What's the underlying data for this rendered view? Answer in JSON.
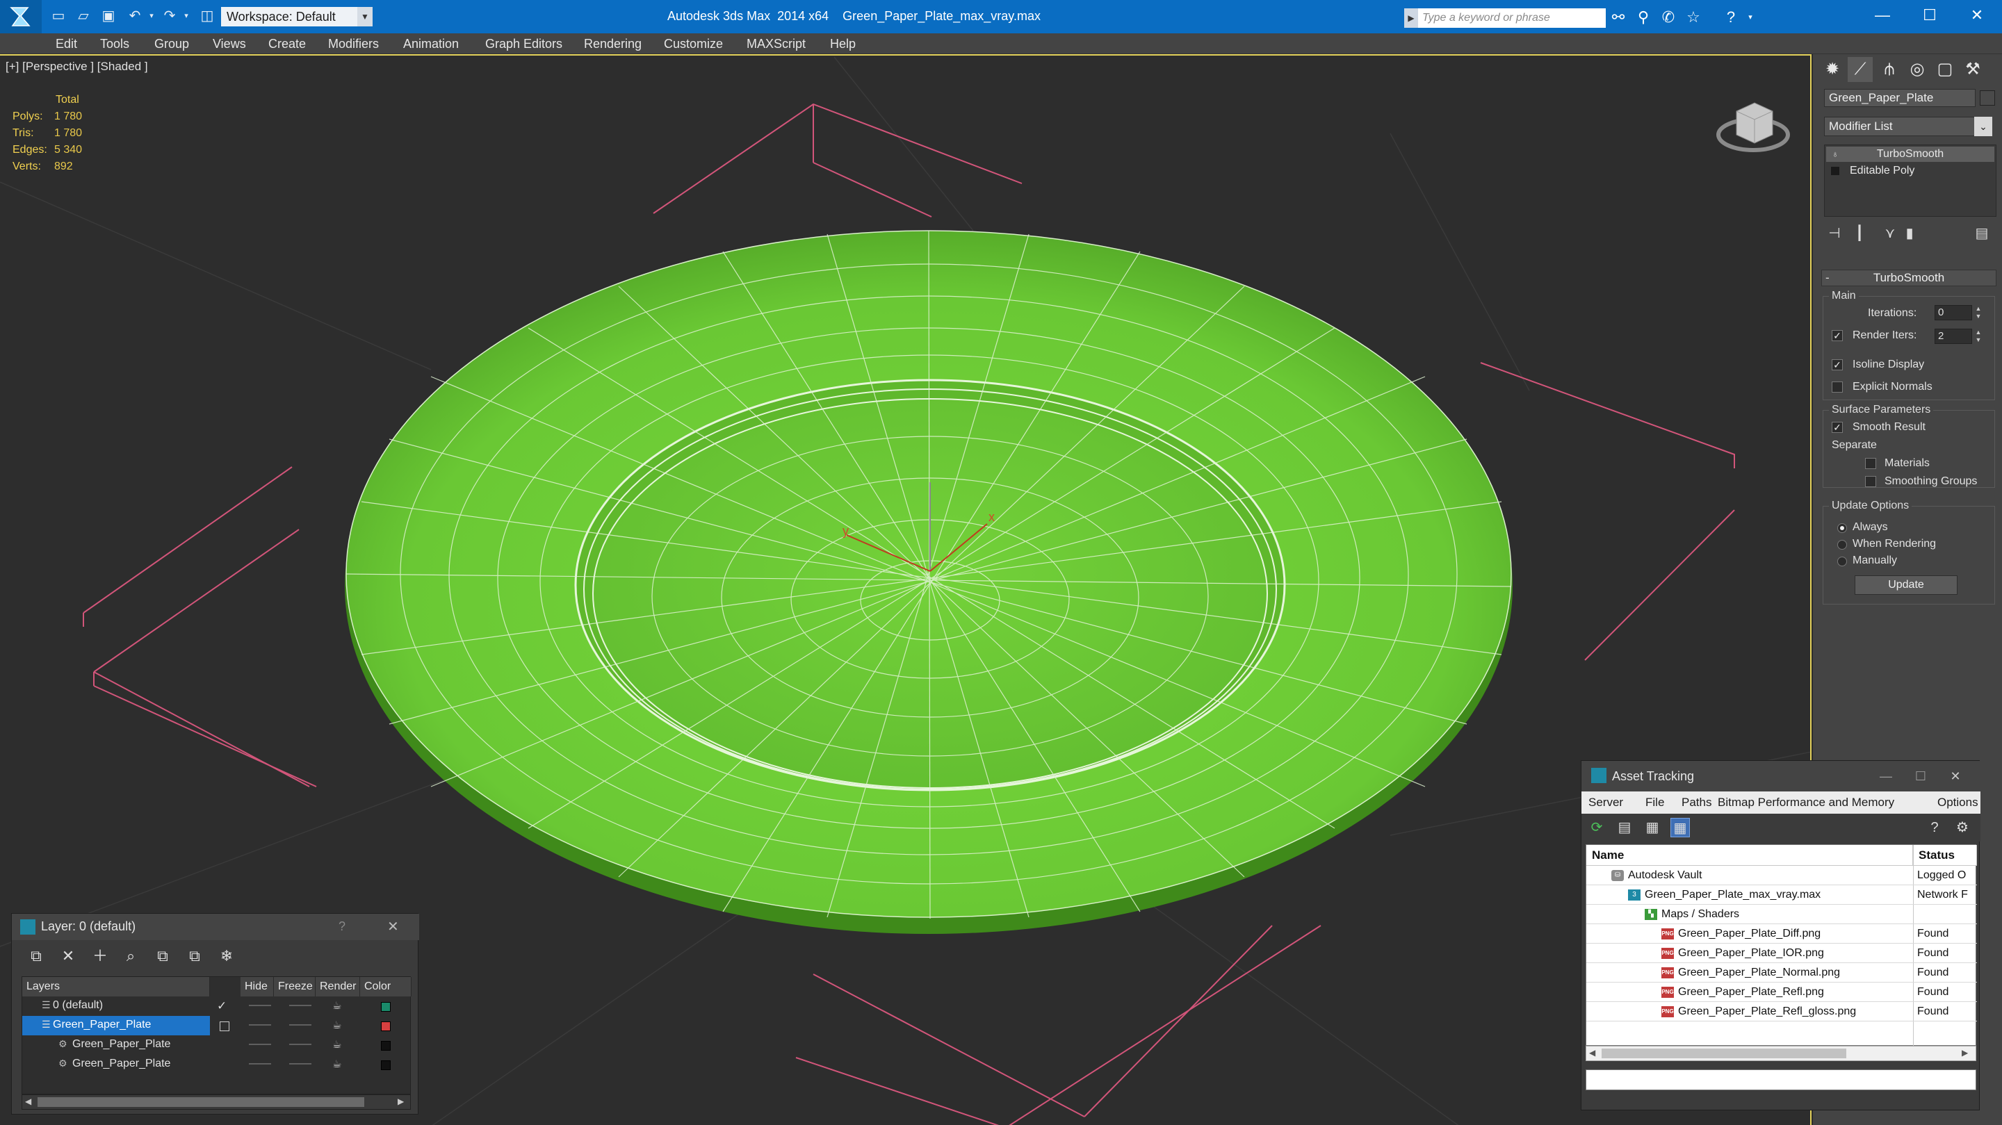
{
  "titlebar": {
    "workspace": "Workspace: Default",
    "app_title": "Autodesk 3ds Max  2014 x64",
    "file_title": "Green_Paper_Plate_max_vray.max",
    "search_placeholder": "Type a keyword or phrase",
    "accent_color": "#0a6dc2"
  },
  "menubar": {
    "items": [
      "Edit",
      "Tools",
      "Group",
      "Views",
      "Create",
      "Modifiers",
      "Animation",
      "Graph Editors",
      "Rendering",
      "Customize",
      "MAXScript",
      "Help"
    ]
  },
  "viewport": {
    "label": "[+] [Perspective ] [Shaded ]",
    "stats": {
      "header": "Total",
      "rows": [
        {
          "label": "Polys:",
          "value": "1 780"
        },
        {
          "label": "Tris:",
          "value": "1 780"
        },
        {
          "label": "Edges:",
          "value": "5 340"
        },
        {
          "label": "Verts:",
          "value": "892"
        }
      ]
    },
    "object_color": "#6cc83a",
    "gizmo_labels": {
      "x": "x",
      "y": "y"
    }
  },
  "command_panel": {
    "object_name": "Green_Paper_Plate",
    "modifier_list": "Modifier List",
    "stack": [
      "TurboSmooth",
      "Editable Poly"
    ],
    "rollout_title": "TurboSmooth",
    "main": {
      "title": "Main",
      "iterations_label": "Iterations:",
      "iterations_value": "0",
      "render_iters_label": "Render Iters:",
      "render_iters_value": "2",
      "render_iters_checked": true,
      "isoline_label": "Isoline Display",
      "isoline_checked": true,
      "explicit_normals_label": "Explicit Normals",
      "explicit_normals_checked": false
    },
    "surface": {
      "title": "Surface Parameters",
      "smooth_result_label": "Smooth Result",
      "smooth_result_checked": true,
      "separate_label": "Separate",
      "materials_label": "Materials",
      "smoothing_groups_label": "Smoothing Groups"
    },
    "update": {
      "title": "Update Options",
      "always": "Always",
      "when_rendering": "When Rendering",
      "manually": "Manually",
      "selected": "Always",
      "button": "Update"
    }
  },
  "layer_dialog": {
    "title": "Layer: 0 (default)",
    "help": "?",
    "columns": [
      "Layers",
      "Hide",
      "Freeze",
      "Render",
      "Color"
    ],
    "rows": [
      {
        "name": "0 (default)",
        "check": "✓",
        "color": "#1a8a6a",
        "selected": false,
        "indent": 0
      },
      {
        "name": "Green_Paper_Plate",
        "check": "",
        "color": "#d64040",
        "selected": true,
        "indent": 0
      },
      {
        "name": "Green_Paper_Plate",
        "check": "",
        "color": "#111111",
        "selected": false,
        "indent": 1
      },
      {
        "name": "Green_Paper_Plate",
        "check": "",
        "color": "#111111",
        "selected": false,
        "indent": 1
      }
    ]
  },
  "asset_dialog": {
    "title": "Asset Tracking",
    "menu": [
      "Server",
      "File",
      "Paths",
      "Bitmap Performance and Memory",
      "Options"
    ],
    "columns": [
      "Name",
      "Status"
    ],
    "rows": [
      {
        "name": "Autodesk Vault",
        "status": "Logged O",
        "icon": "vault",
        "indent": 1
      },
      {
        "name": "Green_Paper_Plate_max_vray.max",
        "status": "Network F",
        "icon": "max",
        "indent": 2
      },
      {
        "name": "Maps / Shaders",
        "status": "",
        "icon": "folder",
        "indent": 3
      },
      {
        "name": "Green_Paper_Plate_Diff.png",
        "status": "Found",
        "icon": "png",
        "indent": 4
      },
      {
        "name": "Green_Paper_Plate_IOR.png",
        "status": "Found",
        "icon": "png",
        "indent": 4
      },
      {
        "name": "Green_Paper_Plate_Normal.png",
        "status": "Found",
        "icon": "png",
        "indent": 4
      },
      {
        "name": "Green_Paper_Plate_Refl.png",
        "status": "Found",
        "icon": "png",
        "indent": 4
      },
      {
        "name": "Green_Paper_Plate_Refl_gloss.png",
        "status": "Found",
        "icon": "png",
        "indent": 4
      }
    ]
  }
}
